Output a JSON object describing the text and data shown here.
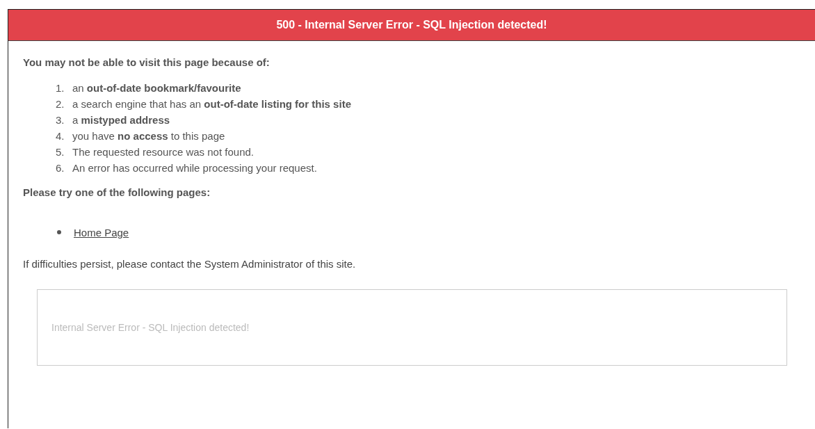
{
  "header": {
    "title": "500 - Internal Server Error - SQL Injection detected!"
  },
  "reasons_heading": "You may not be able to visit this page because of:",
  "reasons": [
    {
      "number": "1.",
      "text": "an **out-of-date bookmark/favourite**"
    },
    {
      "number": "2.",
      "text": "a search engine that has an **out-of-date listing for this site**"
    },
    {
      "number": "3.",
      "text": "a **mistyped address**"
    },
    {
      "number": "4.",
      "text": "you have **no access** to this page"
    },
    {
      "number": "5.",
      "text": "The requested resource was not found."
    },
    {
      "number": "6.",
      "text": "An error has occurred while processing your request."
    }
  ],
  "pages_heading": "Please try one of the following pages:",
  "pages": [
    {
      "label": "Home Page"
    }
  ],
  "contact_note": "If difficulties persist, please contact the System Administrator of this site.",
  "error_detail": "Internal Server Error - SQL Injection detected!"
}
